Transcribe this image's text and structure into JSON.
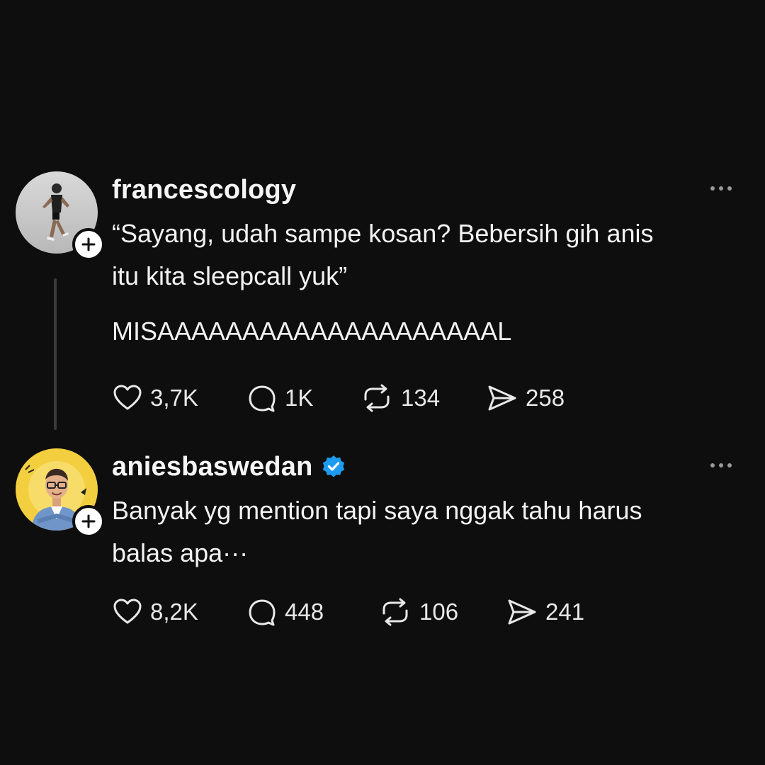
{
  "posts": [
    {
      "username": "francescology",
      "verified": false,
      "text_paragraph_1": "“Sayang, udah sampe kosan? Bebersih gih anis\nitu kita sleepcall yuk”",
      "text_paragraph_2": "MISAAAAAAAAAAAAAAAAAAAAL",
      "likes": "3,7K",
      "replies": "1K",
      "reposts": "134",
      "shares": "258"
    },
    {
      "username": "aniesbaswedan",
      "verified": true,
      "text_paragraph_1": "Banyak yg mention tapi saya nggak tahu harus\nbalas apa···",
      "likes": "8,2K",
      "replies": "448",
      "reposts": "106",
      "shares": "241"
    }
  ],
  "icons": {
    "like": "heart-icon",
    "reply": "speech-bubble-icon",
    "repost": "repost-arrows-icon",
    "share": "paper-plane-icon",
    "more": "more-dots-icon",
    "follow": "plus-icon",
    "verified": "verified-badge-icon"
  },
  "colors": {
    "background": "#0e0e0e",
    "text": "#f2f2f2",
    "verified_blue": "#1d9bf0",
    "thread_line": "#3a3a3a"
  }
}
